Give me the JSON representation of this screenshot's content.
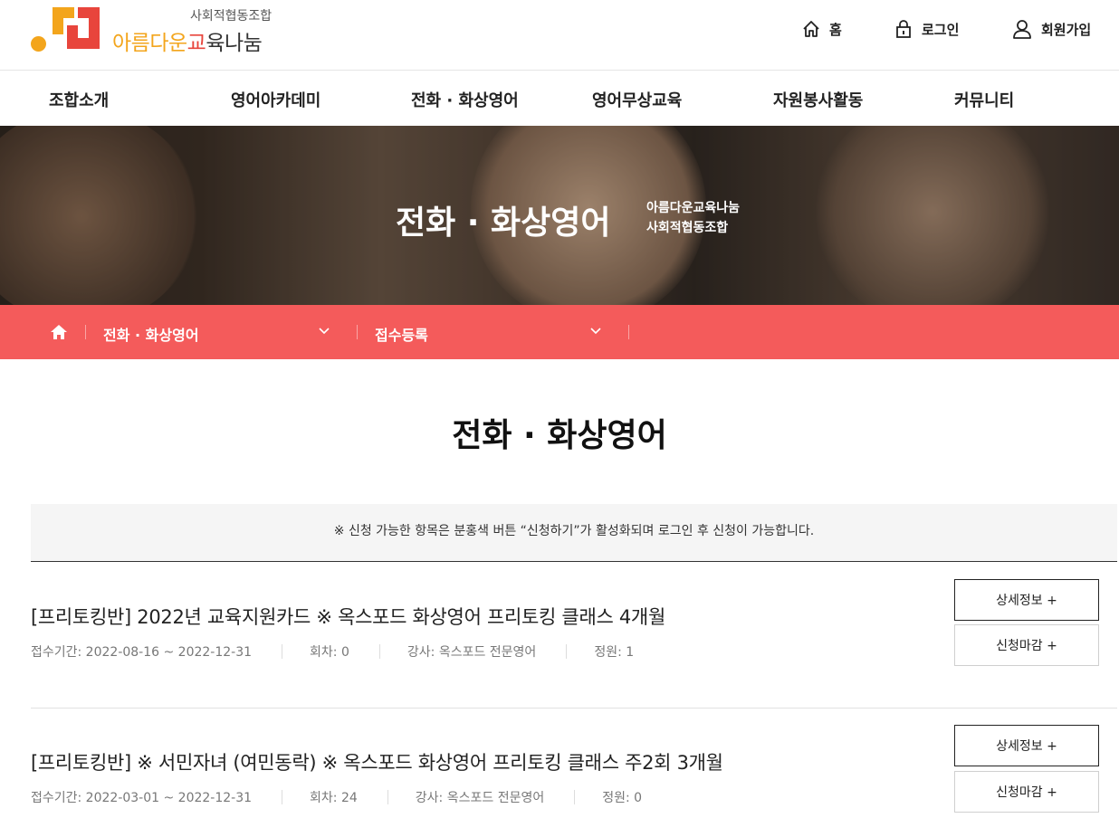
{
  "header": {
    "logo_sub": "사회적협동조합",
    "logo_part1": "아름다운",
    "logo_part2": "교",
    "logo_part3": "육나눔",
    "util": [
      {
        "label": "홈",
        "icon": "home-icon"
      },
      {
        "label": "로그인",
        "icon": "lock-icon"
      },
      {
        "label": "회원가입",
        "icon": "user-icon"
      }
    ]
  },
  "gnb": [
    "조합소개",
    "영어아카데미",
    "전화 · 화상영어",
    "영어무상교육",
    "자원봉사활동",
    "커뮤니티"
  ],
  "banner": {
    "title": "전화 · 화상영어",
    "sub1": "아름다운교육나눔",
    "sub2": "사회적협동조합"
  },
  "location": {
    "depth1": "전화 · 화상영어",
    "depth2": "접수등록"
  },
  "page": {
    "title": "전화 · 화상영어",
    "notice": "※ 신청 가능한 항목은 분홍색 버튼 “신청하기”가 활성화되며 로그인 후 신청이 가능합니다."
  },
  "courses": [
    {
      "title": "[프리토킹반] 2022년 교육지원카드 ※ 옥스포드 화상영어 프리토킹 클래스 4개월",
      "period": "접수기간: 2022-08-16 ~ 2022-12-31",
      "sessions": "회차: 0",
      "teacher": "강사: 옥스포드 전문영어",
      "capacity": "정원: 1",
      "detail_label": "상세정보 +",
      "apply_label": "신청마감 +"
    },
    {
      "title": "[프리토킹반] ※ 서민자녀 (여민동락) ※ 옥스포드 화상영어 프리토킹 클래스 주2회 3개월",
      "period": "접수기간: 2022-03-01 ~ 2022-12-31",
      "sessions": "회차: 24",
      "teacher": "강사: 옥스포드 전문영어",
      "capacity": "정원: 0",
      "detail_label": "상세정보 +",
      "apply_label": "신청마감 +"
    }
  ],
  "colors": {
    "accent": "#f45b5b",
    "logo_orange": "#f3a51c",
    "logo_red": "#e8453c"
  }
}
